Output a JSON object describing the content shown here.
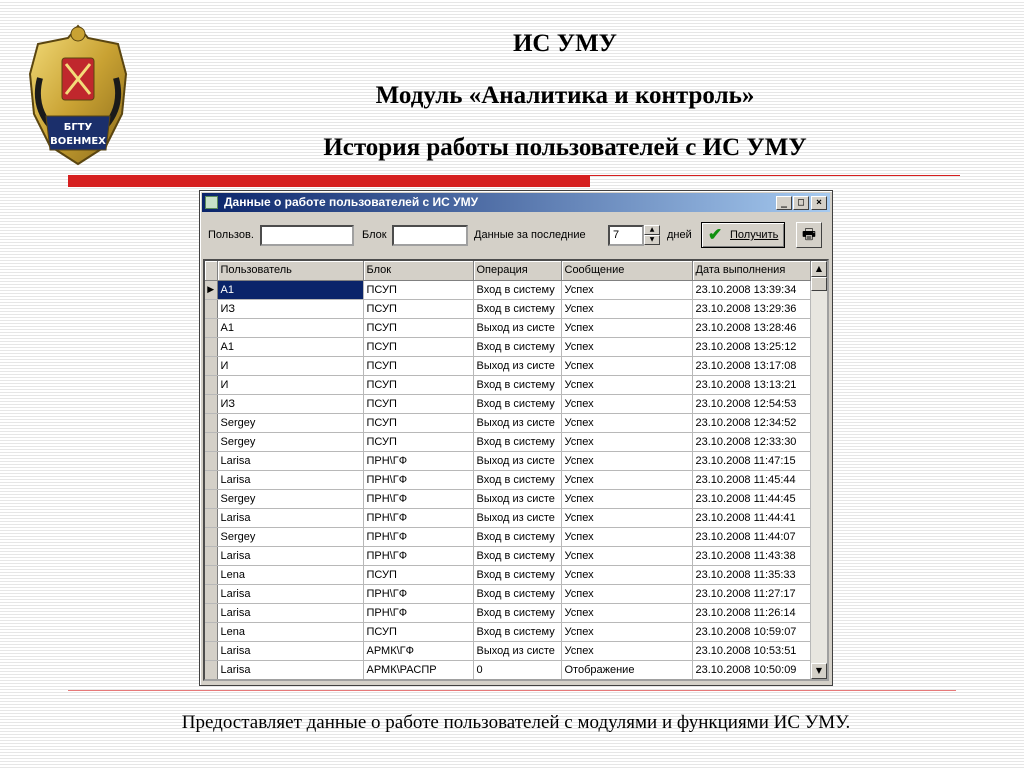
{
  "slide": {
    "title": "ИС УМУ",
    "subtitle": "Модуль «Аналитика и контроль»",
    "heading": "История работы пользователей с ИС УМУ",
    "logo_text": "БГТУ ВОЕНМЕХ",
    "footer": "Предоставляет данные о работе пользователей с модулями и функциями ИС УМУ."
  },
  "window": {
    "title": "Данные о работе пользователей с ИС УМУ",
    "minimize": "_",
    "maximize": "□",
    "close": "×"
  },
  "filter": {
    "user_label": "Пользов.",
    "user_value": "",
    "block_label": "Блок",
    "block_value": "",
    "period_label": "Данные за последние",
    "days_value": "7",
    "days_label": "дней",
    "get_button": "Получить"
  },
  "table": {
    "columns": [
      "Пользователь",
      "Блок",
      "Операция",
      "Сообщение",
      "Дата выполнения"
    ],
    "rows": [
      [
        "А1",
        "ПСУП",
        "Вход в систему",
        "Успех",
        "23.10.2008 13:39:34"
      ],
      [
        "ИЗ",
        "ПСУП",
        "Вход в систему",
        "Успех",
        "23.10.2008 13:29:36"
      ],
      [
        "А1",
        "ПСУП",
        "Выход из систе",
        "Успех",
        "23.10.2008 13:28:46"
      ],
      [
        "А1",
        "ПСУП",
        "Вход в систему",
        "Успех",
        "23.10.2008 13:25:12"
      ],
      [
        "И",
        "ПСУП",
        "Выход из систе",
        "Успех",
        "23.10.2008 13:17:08"
      ],
      [
        "И",
        "ПСУП",
        "Вход в систему",
        "Успех",
        "23.10.2008 13:13:21"
      ],
      [
        "ИЗ",
        "ПСУП",
        "Вход в систему",
        "Успех",
        "23.10.2008 12:54:53"
      ],
      [
        "Sergey",
        "ПСУП",
        "Выход из систе",
        "Успех",
        "23.10.2008 12:34:52"
      ],
      [
        "Sergey",
        "ПСУП",
        "Вход в систему",
        "Успех",
        "23.10.2008 12:33:30"
      ],
      [
        "Larisa",
        "ПРН\\ГФ",
        "Выход из систе",
        "Успех",
        "23.10.2008 11:47:15"
      ],
      [
        "Larisa",
        "ПРН\\ГФ",
        "Вход в систему",
        "Успех",
        "23.10.2008 11:45:44"
      ],
      [
        "Sergey",
        "ПРН\\ГФ",
        "Выход из систе",
        "Успех",
        "23.10.2008 11:44:45"
      ],
      [
        "Larisa",
        "ПРН\\ГФ",
        "Выход из систе",
        "Успех",
        "23.10.2008 11:44:41"
      ],
      [
        "Sergey",
        "ПРН\\ГФ",
        "Вход в систему",
        "Успех",
        "23.10.2008 11:44:07"
      ],
      [
        "Larisa",
        "ПРН\\ГФ",
        "Вход в систему",
        "Успех",
        "23.10.2008 11:43:38"
      ],
      [
        "Lena",
        "ПСУП",
        "Вход в систему",
        "Успех",
        "23.10.2008 11:35:33"
      ],
      [
        "Larisa",
        "ПРН\\ГФ",
        "Вход в систему",
        "Успех",
        "23.10.2008 11:27:17"
      ],
      [
        "Larisa",
        "ПРН\\ГФ",
        "Вход в систему",
        "Успех",
        "23.10.2008 11:26:14"
      ],
      [
        "Lena",
        "ПСУП",
        "Вход в систему",
        "Успех",
        "23.10.2008 10:59:07"
      ],
      [
        "Larisa",
        "АРМК\\ГФ",
        "Выход из систе",
        "Успех",
        "23.10.2008 10:53:51"
      ],
      [
        "Larisa",
        "АРМК\\РАСПР",
        "0",
        "Отображение",
        "23.10.2008 10:50:09"
      ]
    ]
  },
  "colors": {
    "accent_red": "#d62020",
    "titlebar": "#0a246a",
    "selection": "#0a246a",
    "window_face": "#d4d0c8"
  }
}
